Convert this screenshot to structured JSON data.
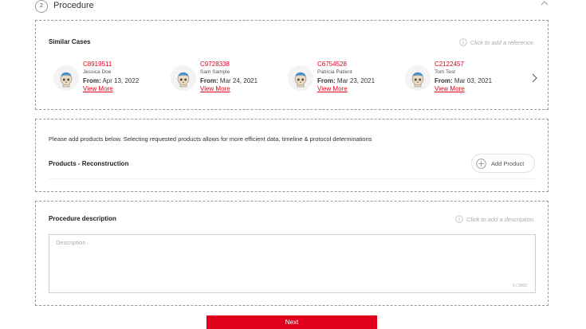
{
  "step": {
    "number": "2",
    "title": "Procedure"
  },
  "similar_cases": {
    "title": "Similar Cases",
    "hint": "Click to add a reference.",
    "from_label": "From:",
    "cases": [
      {
        "id": "C8919511",
        "name": "Jessica Doe",
        "date": "Apr 13, 2022",
        "link": "View More"
      },
      {
        "id": "C9728338",
        "name": "Sam Sample",
        "date": "Mar 24, 2021",
        "link": "View More"
      },
      {
        "id": "C6754528",
        "name": "Patricia Patient",
        "date": "Mar 23, 2021",
        "link": "View More"
      },
      {
        "id": "C2122457",
        "name": "Tom Test",
        "date": "Mar 03, 2021",
        "link": "View More"
      }
    ]
  },
  "products": {
    "instruction": "Please add products below. Selecting requested products allows for more efficient data, timeline & protocol determinations",
    "title": "Products - Reconstruction",
    "add_label": "Add Product"
  },
  "procedure_description": {
    "title": "Procedure description",
    "hint": "Click to add a description.",
    "placeholder": "Description",
    "counter": "0 / 2000"
  },
  "next_label": "Next",
  "colors": {
    "accent": "#e0001b",
    "border": "#9a9a9a",
    "hint": "#aaaaaa",
    "avatar_cap": "#4f8fbf"
  },
  "icons": {
    "collapse": "chevron-up-icon",
    "info": "info-circle-icon",
    "next": "chevron-right-icon",
    "add": "plus-circle-icon",
    "avatar": "skull-avatar-icon"
  }
}
